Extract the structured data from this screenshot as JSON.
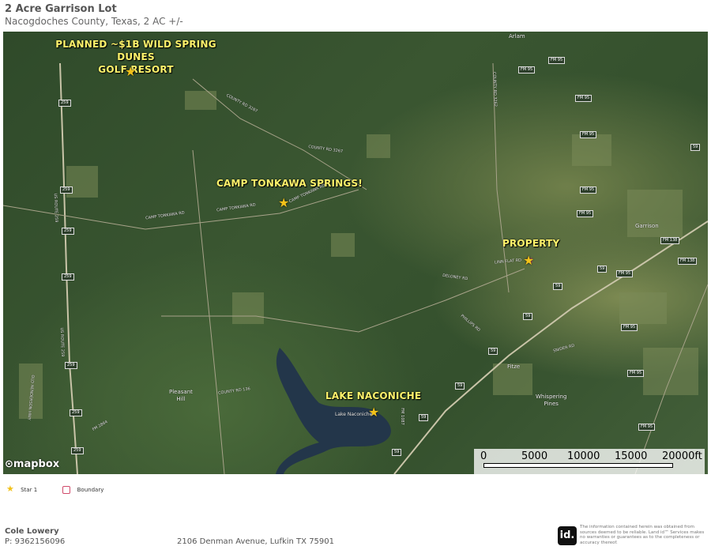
{
  "header": {
    "title": "2 Acre Garrison Lot",
    "subtitle": "Nacogdoches County, Texas, 2 AC +/-"
  },
  "map": {
    "callouts": {
      "golf": [
        "PLANNED ~$1B WILD SPRING DUNES",
        "GOLF RESORT"
      ],
      "camp": "CAMP TONKAWA SPRINGS!",
      "property": "PROPERTY",
      "lake": "LAKE NACONICHE"
    },
    "road_labels": {
      "county_rd_3267_a": "COUNTY RD 3267",
      "county_rd_3267_b": "COUNTY RD 3267",
      "camp_tonkawa_rd_1": "CAMP TONKAWA RD",
      "camp_tonkawa_rd_2": "CAMP TONKAWA RD",
      "camp_tonkawa_rd_3": "CAMP TONKAWA RD",
      "linn_flat_rd": "LINN FLAT RD",
      "deloney_rd": "DELONEY RD",
      "phillips_rd": "PHILLIPS RD",
      "snider_rd": "SNIDER RD",
      "county_rd_136": "COUNTY RD 136",
      "county_rd_3262": "COUNTY RD 3262",
      "us_route_259": "US ROUTE 259",
      "old_henderson_hwy": "OLD HENDERSON HWY",
      "fm_2864": "FM 2864",
      "fm_1087": "FM 1087"
    },
    "shields": {
      "us259": "259",
      "fm95": "FM 95",
      "fm138": "FM 138",
      "us59": "59"
    },
    "places": {
      "arlam": "Arlam",
      "garrison": "Garrison",
      "fitze": "Fitze",
      "whispering_pines": [
        "Whispering",
        "Pines"
      ],
      "pleasant_hill": [
        "Pleasant",
        "Hill"
      ],
      "lake_naconiche_small": "Lake Naconiche"
    },
    "attribution": "mapbox",
    "scale": {
      "ticks": [
        "0",
        "5000",
        "10000",
        "15000",
        "20000ft"
      ]
    },
    "colors": {
      "star": "#f2c21a",
      "callout_text": "#fff36b",
      "boundary": "#d04a6a"
    }
  },
  "legend": {
    "star_label": "Star 1",
    "boundary_label": "Boundary"
  },
  "footer": {
    "agent_name": "Cole Lowery",
    "phone": "P: 9362156096",
    "address": "2106 Denman Avenue, Lufkin TX 75901",
    "logo_text": "id.",
    "disclaimer": "The information contained herein was obtained from sources deemed to be reliable. Land id™ Services makes no warranties or guarantees as to the completeness or accuracy thereof."
  }
}
